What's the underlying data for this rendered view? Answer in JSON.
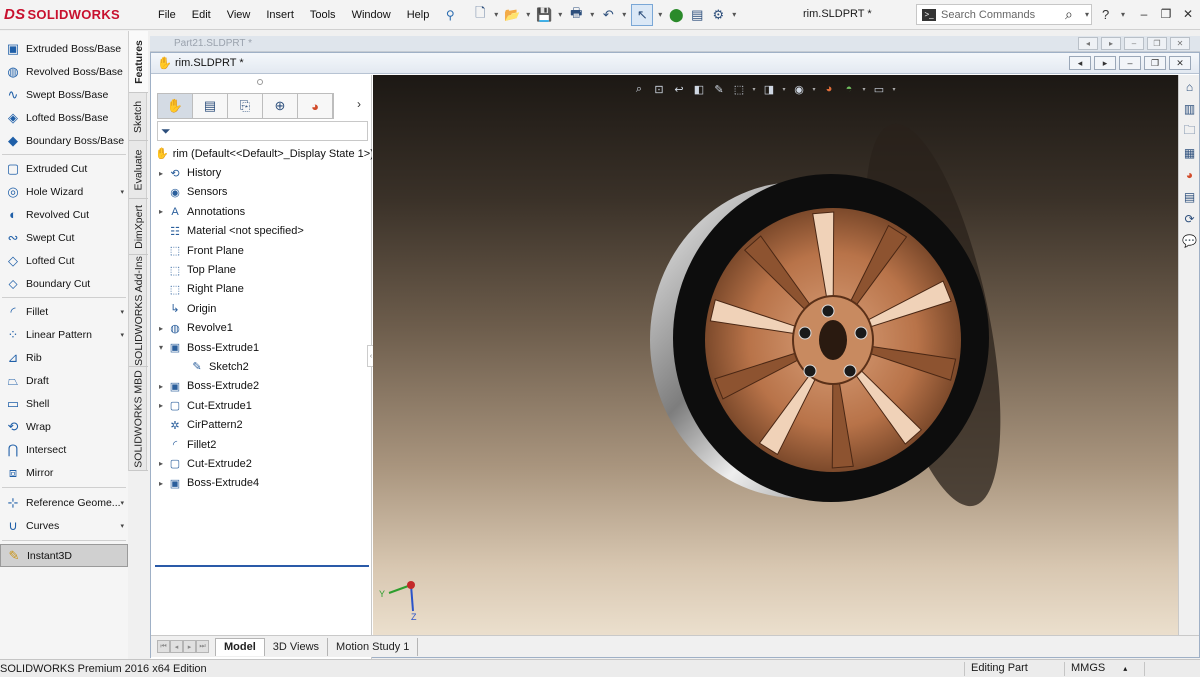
{
  "app": {
    "logo_text": "SOLIDWORKS",
    "logo_mark": "DS"
  },
  "menu": [
    "File",
    "Edit",
    "View",
    "Insert",
    "Tools",
    "Window",
    "Help"
  ],
  "toolbar_icons": [
    "new-icon",
    "open-icon",
    "save-icon",
    "print-icon",
    "undo-icon",
    "select-icon",
    "rebuild-icon",
    "file-properties-icon",
    "options-icon"
  ],
  "document_title": "rim.SLDPRT *",
  "search": {
    "placeholder": "Search Commands"
  },
  "help": {
    "label": "?"
  },
  "commands": [
    {
      "label": "Extruded Boss/Base",
      "icon": "extruded-boss-icon"
    },
    {
      "label": "Revolved Boss/Base",
      "icon": "revolved-boss-icon"
    },
    {
      "label": "Swept Boss/Base",
      "icon": "swept-boss-icon"
    },
    {
      "label": "Lofted Boss/Base",
      "icon": "lofted-boss-icon"
    },
    {
      "label": "Boundary Boss/Base",
      "icon": "boundary-boss-icon"
    },
    {
      "label": "Extruded Cut",
      "icon": "extruded-cut-icon"
    },
    {
      "label": "Hole Wizard",
      "icon": "hole-wizard-icon"
    },
    {
      "label": "Revolved Cut",
      "icon": "revolved-cut-icon"
    },
    {
      "label": "Swept Cut",
      "icon": "swept-cut-icon"
    },
    {
      "label": "Lofted Cut",
      "icon": "lofted-cut-icon"
    },
    {
      "label": "Boundary Cut",
      "icon": "boundary-cut-icon"
    },
    {
      "label": "Fillet",
      "icon": "fillet-icon"
    },
    {
      "label": "Linear Pattern",
      "icon": "linear-pattern-icon"
    },
    {
      "label": "Rib",
      "icon": "rib-icon"
    },
    {
      "label": "Draft",
      "icon": "draft-icon"
    },
    {
      "label": "Shell",
      "icon": "shell-icon"
    },
    {
      "label": "Wrap",
      "icon": "wrap-icon"
    },
    {
      "label": "Intersect",
      "icon": "intersect-icon"
    },
    {
      "label": "Mirror",
      "icon": "mirror-icon"
    },
    {
      "label": "Reference Geome...",
      "icon": "reference-geometry-icon"
    },
    {
      "label": "Curves",
      "icon": "curves-icon"
    },
    {
      "label": "Instant3D",
      "icon": "instant3d-icon"
    }
  ],
  "vertical_tabs": [
    "Features",
    "Sketch",
    "Evaluate",
    "DimXpert",
    "SOLIDWORKS Add-Ins",
    "SOLIDWORKS MBD"
  ],
  "background_document": {
    "title": "Part21.SLDPRT *"
  },
  "feature_manager": {
    "tab_icons": [
      "featuremanager-tab-icon",
      "propertymanager-tab-icon",
      "configurationmanager-tab-icon",
      "dimxpertmanager-tab-icon",
      "displaymanager-tab-icon"
    ],
    "root": "rim  (Default<<Default>_Display State 1>)",
    "items": [
      {
        "label": "History",
        "icon": "history-icon",
        "expander": "▸"
      },
      {
        "label": "Sensors",
        "icon": "sensors-icon",
        "expander": ""
      },
      {
        "label": "Annotations",
        "icon": "annotations-icon",
        "expander": "▸"
      },
      {
        "label": "Material <not specified>",
        "icon": "material-icon",
        "expander": ""
      },
      {
        "label": "Front Plane",
        "icon": "plane-icon",
        "expander": ""
      },
      {
        "label": "Top Plane",
        "icon": "plane-icon",
        "expander": ""
      },
      {
        "label": "Right Plane",
        "icon": "plane-icon",
        "expander": ""
      },
      {
        "label": "Origin",
        "icon": "origin-icon",
        "expander": ""
      },
      {
        "label": "Revolve1",
        "icon": "revolve-feature-icon",
        "expander": "▸"
      },
      {
        "label": "Boss-Extrude1",
        "icon": "extrude-feature-icon",
        "expander": "▾"
      },
      {
        "label": "Sketch2",
        "icon": "sketch-icon",
        "expander": "",
        "indent": true
      },
      {
        "label": "Boss-Extrude2",
        "icon": "extrude-feature-icon",
        "expander": "▸"
      },
      {
        "label": "Cut-Extrude1",
        "icon": "cut-extrude-feature-icon",
        "expander": "▸"
      },
      {
        "label": "CirPattern2",
        "icon": "circular-pattern-icon",
        "expander": ""
      },
      {
        "label": "Fillet2",
        "icon": "fillet-feature-icon",
        "expander": ""
      },
      {
        "label": "Cut-Extrude2",
        "icon": "cut-extrude-feature-icon",
        "expander": "▸"
      },
      {
        "label": "Boss-Extrude4",
        "icon": "extrude-feature-icon",
        "expander": "▸"
      }
    ]
  },
  "heads_up_toolbar_icons": [
    "zoom-to-fit-icon",
    "zoom-to-area-icon",
    "previous-view-icon",
    "section-view-icon",
    "dynamic-annotation-icon",
    "view-orientation-icon",
    "display-style-icon",
    "hide-show-items-icon",
    "edit-appearance-icon",
    "apply-scene-icon",
    "view-settings-icon"
  ],
  "task_pane_icons": [
    "home-icon",
    "design-library-icon",
    "file-explorer-icon",
    "view-palette-icon",
    "appearances-icon",
    "custom-properties-icon",
    "solidworks-forum-icon",
    "solidworks-resources-icon"
  ],
  "triad": {
    "x": "X",
    "y": "Y",
    "z": "Z"
  },
  "bottom_tabs": [
    "Model",
    "3D Views",
    "Motion Study 1"
  ],
  "status": {
    "edition": "SOLIDWORKS Premium 2016 x64 Edition",
    "mode": "Editing Part",
    "units": "MMGS",
    "units_arrow": "▴"
  },
  "colors": {
    "brand": "#c8102e",
    "selection": "#2a5aa8",
    "viewport_top": "#1c1814",
    "viewport_bottom": "#ebdfcd",
    "rim_copper": "#b87349",
    "tire": "#0d0d0d"
  }
}
